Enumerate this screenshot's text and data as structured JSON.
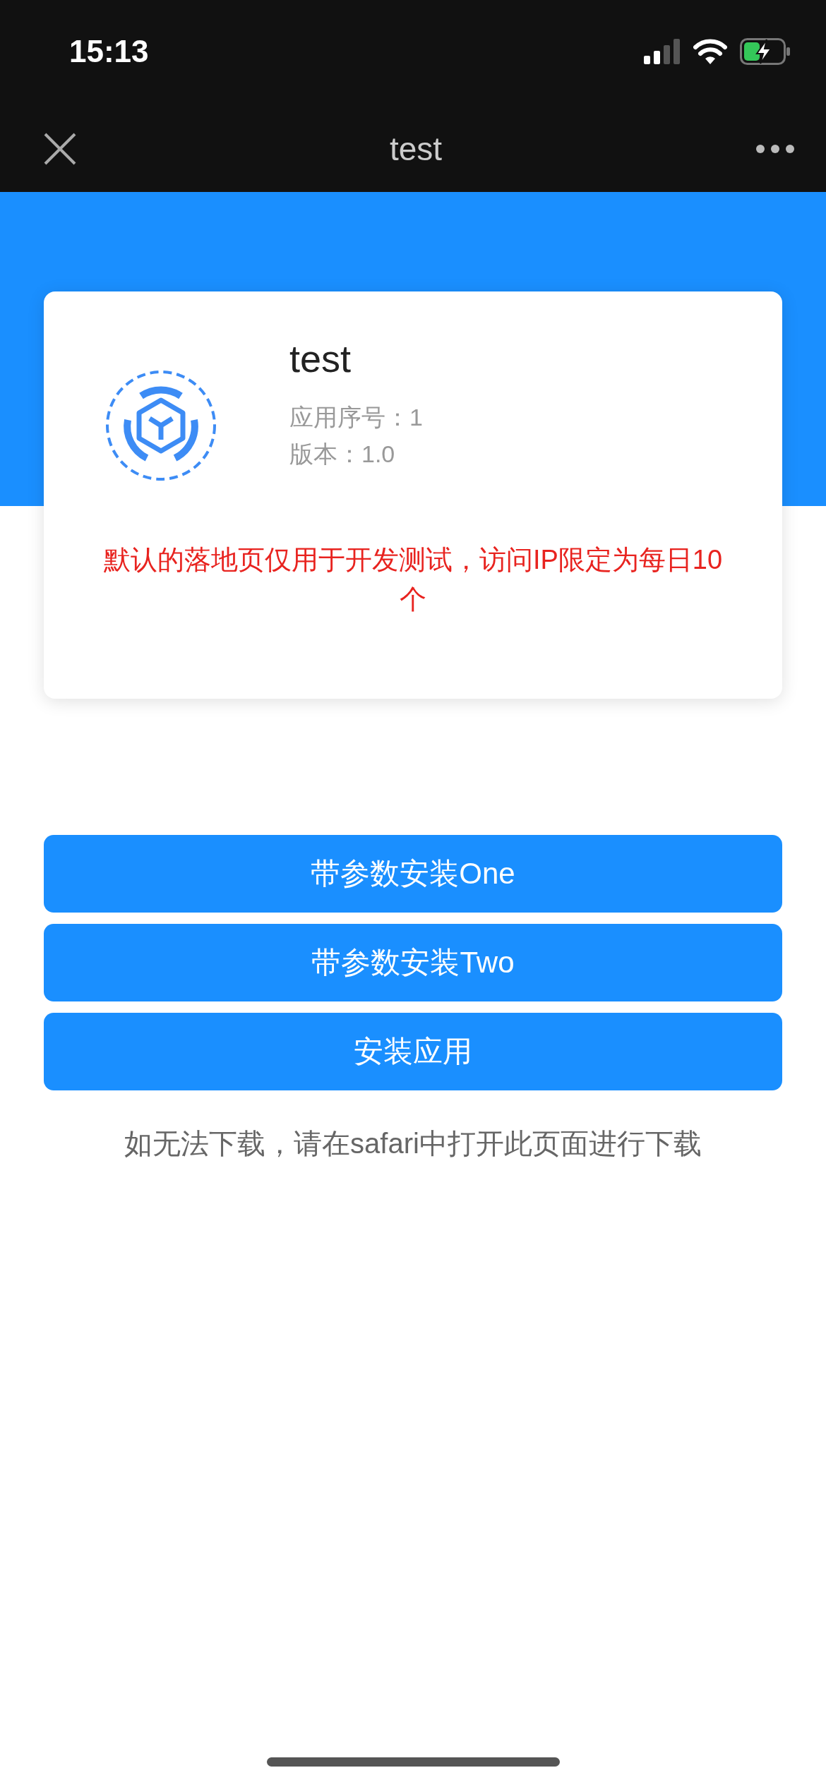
{
  "status_bar": {
    "time": "15:13"
  },
  "nav_bar": {
    "title": "test"
  },
  "app": {
    "name": "test",
    "details": [
      "应用序号：1",
      "版本：1.0"
    ],
    "notice": "默认的落地页仅用于开发测试，访问IP限定为每日10个"
  },
  "buttons": [
    {
      "label": "带参数安装One"
    },
    {
      "label": "带参数安装Two"
    },
    {
      "label": "安装应用"
    }
  ],
  "footer_note": "如无法下载，请在safari中打开此页面进行下载"
}
